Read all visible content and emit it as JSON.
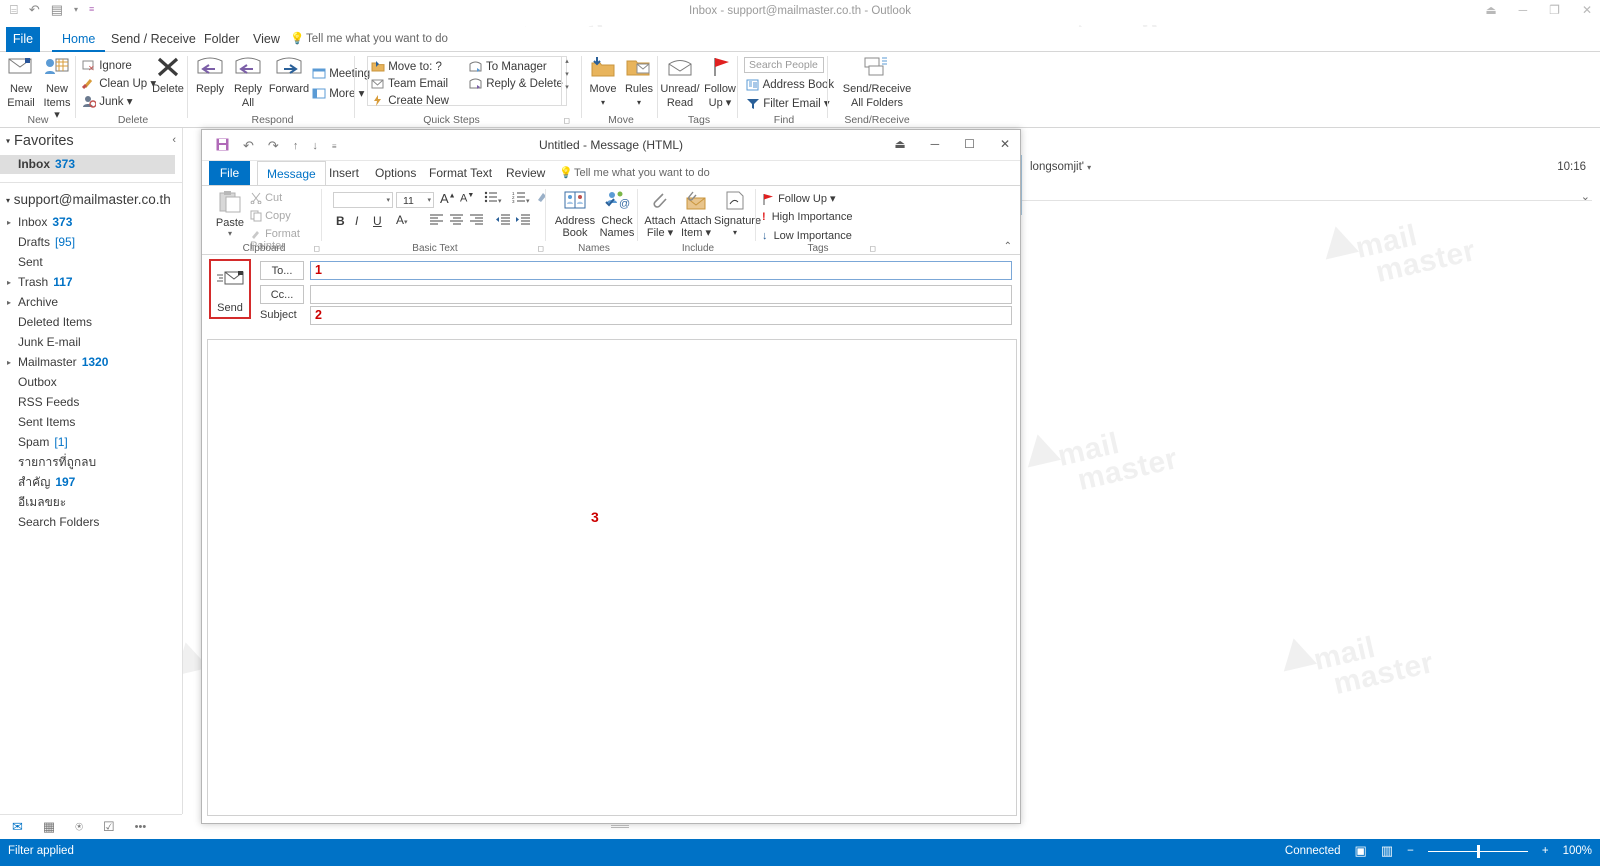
{
  "main_window": {
    "title": "Inbox - support@mailmaster.co.th - Outlook",
    "quick_access": [
      {
        "name": "customize-quick-access-icon",
        "glyph": "⌸"
      },
      {
        "name": "undo-icon",
        "glyph": "↶"
      },
      {
        "name": "send-receive-all-icon",
        "glyph": "▤"
      },
      {
        "name": "quick-access-dropdown-icon",
        "glyph": "▾"
      },
      {
        "name": "customize-toolbar-icon",
        "glyph": "≡"
      }
    ],
    "window_buttons": [
      {
        "name": "ribbon-display-options-icon",
        "glyph": "⏏"
      },
      {
        "name": "minimize-icon",
        "glyph": "─"
      },
      {
        "name": "restore-icon",
        "glyph": "❐"
      },
      {
        "name": "close-icon",
        "glyph": "✕"
      }
    ],
    "tabs": [
      {
        "label": "File",
        "id": "file"
      },
      {
        "label": "Home",
        "id": "home"
      },
      {
        "label": "Send / Receive",
        "id": "send-receive"
      },
      {
        "label": "Folder",
        "id": "folder"
      },
      {
        "label": "View",
        "id": "view"
      }
    ],
    "active_tab": "Home",
    "tell_me": "Tell me what you want to do"
  },
  "ribbon": {
    "groups": [
      {
        "id": "new",
        "label": "New"
      },
      {
        "id": "delete",
        "label": "Delete"
      },
      {
        "id": "respond",
        "label": "Respond"
      },
      {
        "id": "quick-steps",
        "label": "Quick Steps"
      },
      {
        "id": "move",
        "label": "Move"
      },
      {
        "id": "tags",
        "label": "Tags"
      },
      {
        "id": "find",
        "label": "Find"
      },
      {
        "id": "send-receive",
        "label": "Send/Receive"
      }
    ],
    "new_email": "New\nEmail",
    "new_email_l1": "New",
    "new_email_l2": "Email",
    "new_items_l1": "New",
    "new_items_l2": "Items ▾",
    "ignore": "Ignore",
    "clean_up": "Clean Up ▾",
    "junk": "Junk ▾",
    "delete": "Delete",
    "reply": "Reply",
    "reply_all_l1": "Reply",
    "reply_all_l2": "All",
    "forward": "Forward",
    "meeting": "Meeting",
    "more": "More ▾",
    "move_to": "Move to: ?",
    "team_email": "Team Email",
    "create_new": "Create New",
    "to_manager": "To Manager",
    "reply_delete": "Reply & Delete",
    "move_l1": "Move",
    "move_l2": "▾",
    "rules_l1": "Rules",
    "rules_l2": "▾",
    "unread_read_l1": "Unread/",
    "unread_read_l2": "Read",
    "follow_up_l1": "Follow",
    "follow_up_l2": "Up ▾",
    "search_people_placeholder": "Search People",
    "address_book": "Address Book",
    "filter_email": "Filter Email ▾",
    "send_receive_l1": "Send/Receive",
    "send_receive_l2": "All Folders"
  },
  "nav": {
    "favorites_header": "Favorites",
    "collapse_icon": "‹",
    "favorites": [
      {
        "label": "Inbox",
        "count": "373",
        "selected": true,
        "bold": true
      }
    ],
    "account": "support@mailmaster.co.th",
    "folders": [
      {
        "label": "Inbox",
        "count": "373",
        "expandable": true
      },
      {
        "label": "Drafts",
        "count": "[95]",
        "expandable": false,
        "plain_count": true
      },
      {
        "label": "Sent",
        "count": "",
        "expandable": false
      },
      {
        "label": "Trash",
        "count": "117",
        "expandable": true
      },
      {
        "label": "Archive",
        "count": "",
        "expandable": true
      },
      {
        "label": "Deleted Items",
        "count": "",
        "expandable": false
      },
      {
        "label": "Junk E-mail",
        "count": "",
        "expandable": false
      },
      {
        "label": "Mailmaster",
        "count": "1320",
        "expandable": true
      },
      {
        "label": "Outbox",
        "count": "",
        "expandable": false
      },
      {
        "label": "RSS Feeds",
        "count": "",
        "expandable": false
      },
      {
        "label": "Sent Items",
        "count": "",
        "expandable": false
      },
      {
        "label": "Spam",
        "count": "[1]",
        "expandable": false,
        "plain_count": true
      },
      {
        "label": "รายการที่ถูกลบ",
        "count": "",
        "expandable": false
      },
      {
        "label": "สำคัญ",
        "count": "197",
        "expandable": false
      },
      {
        "label": "อีเมลขยะ",
        "count": "",
        "expandable": false
      },
      {
        "label": "Search Folders",
        "count": "",
        "expandable": false
      }
    ],
    "bottom_bar": [
      {
        "name": "mail-icon",
        "glyph": "✉",
        "active": true
      },
      {
        "name": "calendar-icon",
        "glyph": "▦",
        "active": false
      },
      {
        "name": "people-icon",
        "glyph": "⍟",
        "active": false
      },
      {
        "name": "tasks-icon",
        "glyph": "☑",
        "active": false
      },
      {
        "name": "more-options-icon",
        "glyph": "•••",
        "active": false
      }
    ]
  },
  "message_list": {
    "partial_sender": "longsomjit'",
    "partial_dropdown": "▾",
    "partial_time": "10:16",
    "expand_icon": "⌄"
  },
  "compose_window": {
    "title": "Untitled  -  Message (HTML)",
    "quick_access": [
      {
        "name": "save-icon",
        "glyph": "Ὃe"
      },
      {
        "name": "undo-icon",
        "glyph": "↶"
      },
      {
        "name": "redo-icon",
        "glyph": "↷"
      },
      {
        "name": "previous-item-icon",
        "glyph": "↑"
      },
      {
        "name": "next-item-icon",
        "glyph": "↓"
      },
      {
        "name": "customize-toolbar-icon",
        "glyph": "≡"
      }
    ],
    "window_buttons": [
      {
        "name": "ribbon-display-options-icon",
        "glyph": "⏏"
      },
      {
        "name": "minimize-icon",
        "glyph": "─"
      },
      {
        "name": "maximize-icon",
        "glyph": "☐"
      },
      {
        "name": "close-icon",
        "glyph": "✕"
      }
    ],
    "tabs": [
      {
        "label": "File",
        "id": "file"
      },
      {
        "label": "Message",
        "id": "message"
      },
      {
        "label": "Insert",
        "id": "insert"
      },
      {
        "label": "Options",
        "id": "options"
      },
      {
        "label": "Format Text",
        "id": "format-text"
      },
      {
        "label": "Review",
        "id": "review"
      }
    ],
    "active_tab": "Message",
    "tell_me": "Tell me what you want to do",
    "groups": [
      {
        "id": "clipboard",
        "label": "Clipboard"
      },
      {
        "id": "basic-text",
        "label": "Basic Text"
      },
      {
        "id": "names",
        "label": "Names"
      },
      {
        "id": "include",
        "label": "Include"
      },
      {
        "id": "tags",
        "label": "Tags"
      }
    ],
    "paste": "Paste",
    "paste_arrow": "▾",
    "cut": "Cut",
    "copy": "Copy",
    "format_painter": "Format Painter",
    "font_name": "",
    "font_size": "11",
    "grow_font": "A",
    "shrink_font": "A",
    "bold": "B",
    "italic": "I",
    "underline": "U",
    "font_color": "A",
    "address_book_l1": "Address",
    "address_book_l2": "Book",
    "check_names_l1": "Check",
    "check_names_l2": "Names",
    "attach_file_l1": "Attach",
    "attach_file_l2": "File ▾",
    "attach_item_l1": "Attach",
    "attach_item_l2": "Item ▾",
    "signature_l1": "Signature",
    "signature_l2": "▾",
    "follow_up": "Follow Up ▾",
    "high_importance": "High Importance",
    "low_importance": "Low Importance",
    "ribbon_collapse": "⌃",
    "fields": {
      "send_label": "Send",
      "to_label": "To...",
      "cc_label": "Cc...",
      "subject_label": "Subject",
      "to_value": "1",
      "cc_value": "",
      "subject_value": "2",
      "body_value": "3"
    }
  },
  "status_bar": {
    "left_text": "Filter applied",
    "connected": "Connected",
    "view_normal_icon": "▣",
    "view_reading_icon": "▥",
    "zoom_out": "−",
    "zoom_in": "+",
    "zoom_level": "100%"
  },
  "watermark": {
    "line1": "mail",
    "line2": "master"
  },
  "colors": {
    "accent": "#0072c6",
    "annotation": "#cc0000",
    "highlight_box": "#d42b2b",
    "selected_row": "#dedede"
  }
}
